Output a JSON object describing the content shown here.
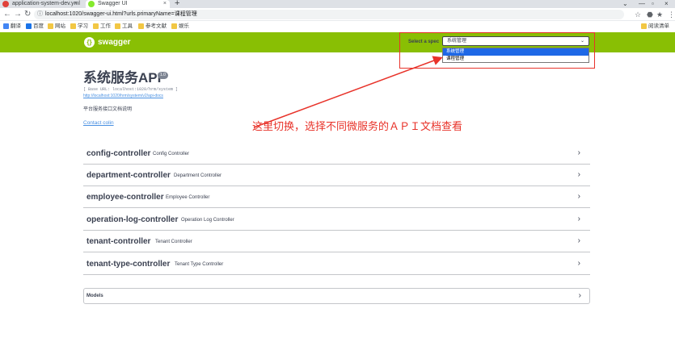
{
  "browser": {
    "tabs": [
      {
        "title": "application-system-dev.yml",
        "close": "×"
      },
      {
        "title": "Swagger UI",
        "close": "×"
      }
    ],
    "new_tab": "+",
    "window_controls": [
      "⌄",
      "—",
      "▫",
      "×"
    ],
    "nav": {
      "back": "←",
      "forward": "→",
      "reload": "↻"
    },
    "url": "localhost:1020/swagger-ui.html?urls.primaryName=课程管理",
    "url_icon": "ⓘ",
    "addr_icons": [
      "☆",
      "⬣",
      "★",
      "⋮"
    ],
    "bookmarks": [
      {
        "label": "翻译",
        "icon": "ms"
      },
      {
        "label": "百度",
        "icon": "blue"
      },
      {
        "label": "网站",
        "icon": "folder"
      },
      {
        "label": "学习",
        "icon": "folder"
      },
      {
        "label": "工作",
        "icon": "folder"
      },
      {
        "label": "工具",
        "icon": "folder"
      },
      {
        "label": "参考文献",
        "icon": "folder"
      },
      {
        "label": "娱乐",
        "icon": "folder"
      },
      {
        "label": "阅读清单",
        "icon": "folder"
      }
    ]
  },
  "topbar": {
    "logo_mark": "{}",
    "logo_text": "swagger",
    "spec_label": "Select a spec",
    "spec_selected": "系统管理",
    "spec_arrow": "⌄",
    "spec_options": [
      "系统管理",
      "课程管理"
    ]
  },
  "info": {
    "title": "系统服务API",
    "version": "1.0",
    "base_url": "[ Base URL: localhost:1020/hrm/system ]",
    "spec_url": "http://localhost:1020/hrm/system/v2/api-docs",
    "description": "平台服务接口文档说明",
    "contact": "Contact colin"
  },
  "annotation": {
    "text": "这里切换，选择不同微服务的ＡＰＩ文档查看",
    "color": "#e8332a"
  },
  "tags": [
    {
      "name": "config-controller",
      "desc": "Config Controller",
      "chevron": "›"
    },
    {
      "name": "department-controller",
      "desc": "Department Controller",
      "chevron": "›"
    },
    {
      "name": "employee-controller",
      "desc": "Employee Controller",
      "chevron": "›"
    },
    {
      "name": "operation-log-controller",
      "desc": "Operation Log Controller",
      "chevron": "›"
    },
    {
      "name": "tenant-controller",
      "desc": "Tenant Controller",
      "chevron": "›"
    },
    {
      "name": "tenant-type-controller",
      "desc": "Tenant Type Controller",
      "chevron": "›"
    }
  ],
  "models": {
    "title": "Models",
    "chevron": "›"
  },
  "colors": {
    "topbar": "#89bf04",
    "link": "#4990e2",
    "text": "#3b4151",
    "selected_option": "#1e68e6"
  }
}
